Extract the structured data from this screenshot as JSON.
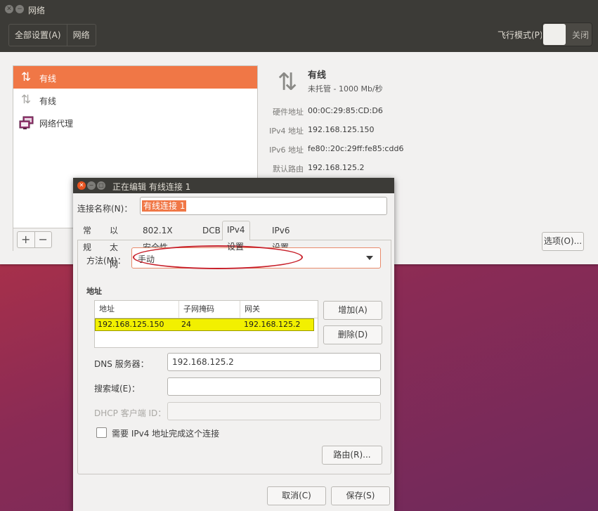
{
  "main": {
    "title": "网络",
    "nav": {
      "all_settings": "全部设置(A)",
      "network": "网络"
    },
    "airplane": {
      "label": "飞行模式(P)",
      "state": "关闭"
    },
    "list": [
      {
        "label": "有线",
        "icon": "network-transmit-receive-icon",
        "selected": true
      },
      {
        "label": "有线",
        "icon": "network-transmit-receive-icon",
        "selected": false
      },
      {
        "label": "网络代理",
        "icon": "network-proxy-icon",
        "selected": false
      }
    ],
    "list_footer": {
      "add": "+",
      "remove": "−"
    },
    "detail": {
      "name": "有线",
      "status": "未托管 - 1000 Mb/秒",
      "rows": [
        {
          "key": "硬件地址",
          "value": "00:0C:29:85:CD:D6"
        },
        {
          "key": "IPv4 地址",
          "value": "192.168.125.150"
        },
        {
          "key": "IPv6 地址",
          "value": "fe80::20c:29ff:fe85:cdd6"
        },
        {
          "key": "默认路由",
          "value": "192.168.125.2"
        }
      ],
      "options_button": "选项(O)..."
    }
  },
  "dialog": {
    "title": "正在编辑 有线连接 1",
    "conn_name_label": "连接名称(N)：",
    "conn_name_value": "有线连接 1",
    "tabs": [
      "常规",
      "以太网",
      "802.1X 安全性",
      "DCB",
      "IPv4 设置",
      "IPv6 设置"
    ],
    "active_tab": "IPv4 设置",
    "method_label": "方法(M)：",
    "method_value": "手动",
    "address_heading": "地址",
    "address_columns": [
      "地址",
      "子网掩码",
      "网关"
    ],
    "address_row": {
      "address": "192.168.125.150",
      "netmask": "24",
      "gateway": "192.168.125.2"
    },
    "add_button": "增加(A)",
    "delete_button": "删除(D)",
    "dns_label": "DNS 服务器：",
    "dns_value": "192.168.125.2",
    "search_label": "搜索域(E)：",
    "search_value": "",
    "dhcp_label": "DHCP 客户端 ID：",
    "dhcp_value": "",
    "require_label": "需要 IPv4 地址完成这个连接",
    "routes_button": "路由(R)...",
    "cancel_button": "取消(C)",
    "save_button": "保存(S)"
  },
  "colors": {
    "accent": "#f07746",
    "titlebar": "#3c3b37",
    "highlight_row": "#f2f000",
    "annotation": "#c8202a"
  }
}
